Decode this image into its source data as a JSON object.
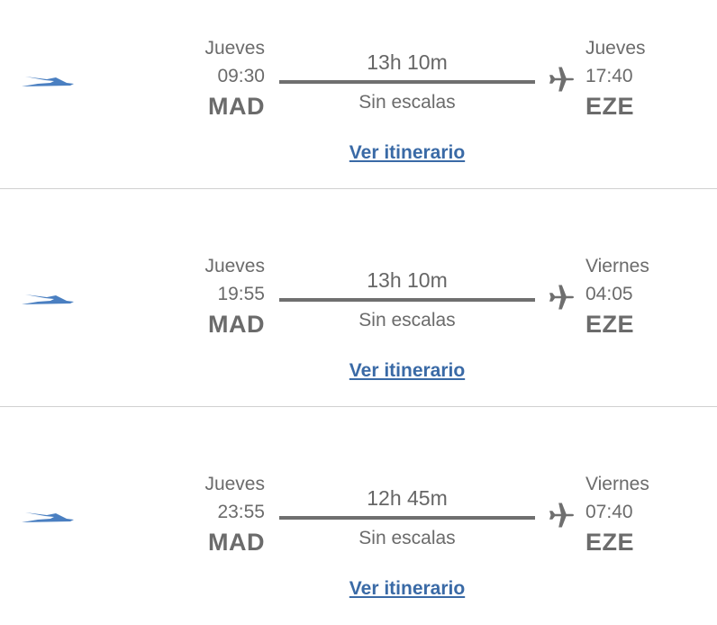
{
  "colors": {
    "link": "#3a6aa6",
    "text": "#666666",
    "divider": "#d0d0d0",
    "logo": "#4a7fc1"
  },
  "icons": {
    "airline": "airline-bird-logo-icon",
    "plane": "airplane-icon"
  },
  "flights": [
    {
      "departure": {
        "day": "Jueves",
        "time": "09:30",
        "code": "MAD"
      },
      "duration": "13h 10m",
      "stops": "Sin escalas",
      "arrival": {
        "day": "Jueves",
        "time": "17:40",
        "code": "EZE"
      },
      "link_label": "Ver itinerario"
    },
    {
      "departure": {
        "day": "Jueves",
        "time": "19:55",
        "code": "MAD"
      },
      "duration": "13h 10m",
      "stops": "Sin escalas",
      "arrival": {
        "day": "Viernes",
        "time": "04:05",
        "code": "EZE"
      },
      "link_label": "Ver itinerario"
    },
    {
      "departure": {
        "day": "Jueves",
        "time": "23:55",
        "code": "MAD"
      },
      "duration": "12h 45m",
      "stops": "Sin escalas",
      "arrival": {
        "day": "Viernes",
        "time": "07:40",
        "code": "EZE"
      },
      "link_label": "Ver itinerario"
    }
  ]
}
